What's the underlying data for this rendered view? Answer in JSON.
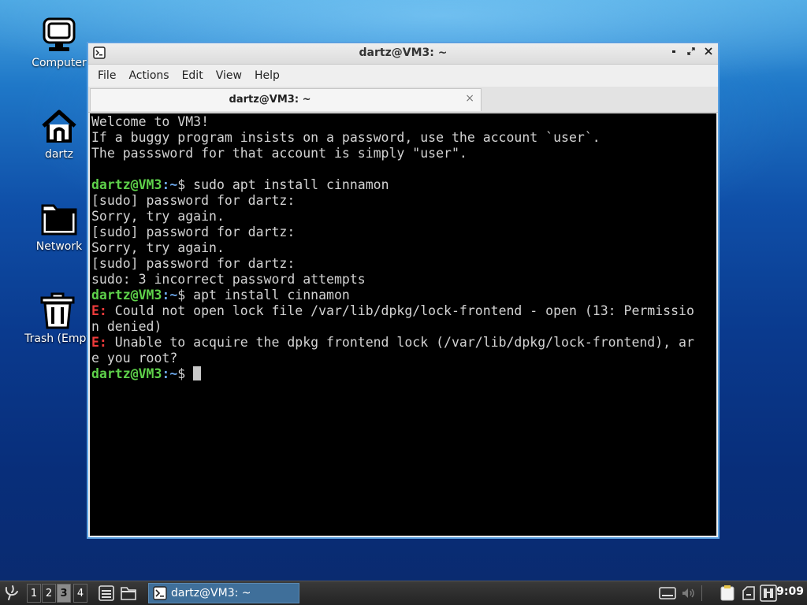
{
  "desktop": {
    "icons": [
      {
        "label": "Computer",
        "icon": "computer-icon"
      },
      {
        "label": "dartz",
        "icon": "home-icon"
      },
      {
        "label": "Network",
        "icon": "folder-icon"
      },
      {
        "label": "Trash (Empt",
        "icon": "trash-icon"
      }
    ]
  },
  "window": {
    "title": "dartz@VM3: ~",
    "menu": [
      "File",
      "Actions",
      "Edit",
      "View",
      "Help"
    ],
    "tab": {
      "label": "dartz@VM3: ~",
      "close": "×"
    },
    "controls": {
      "minimize": "▪",
      "maximize": "⤢",
      "close": "✕"
    }
  },
  "terminal": {
    "prompt_user": "dartz@VM3",
    "prompt_path": ":~",
    "prompt_symbol": "$ ",
    "error_prefix": "E:",
    "lines": [
      "Welcome to VM3!",
      "If a buggy program insists on a password, use the account `user`.",
      "The passsword for that account is simply \"user\".",
      "",
      "sudo apt install cinnamon",
      "[sudo] password for dartz:",
      "Sorry, try again.",
      "[sudo] password for dartz:",
      "Sorry, try again.",
      "[sudo] password for dartz:",
      "sudo: 3 incorrect password attempts",
      "apt install cinnamon",
      " Could not open lock file /var/lib/dpkg/lock-frontend - open (13: Permissio",
      "n denied)",
      " Unable to acquire the dpkg frontend lock (/var/lib/dpkg/lock-frontend), ar",
      "e you root?",
      ""
    ]
  },
  "taskbar": {
    "desktops": [
      "1",
      "2",
      "3",
      "4"
    ],
    "active_desktop": "3",
    "task_label": "dartz@VM3: ~",
    "clock": "9:09"
  },
  "colors": {
    "prompt_user": "#5ed14a",
    "prompt_path": "#6aa5e8",
    "error": "#ef3b3b",
    "window_border": "#5aa0e0",
    "terminal_bg": "#000000"
  }
}
